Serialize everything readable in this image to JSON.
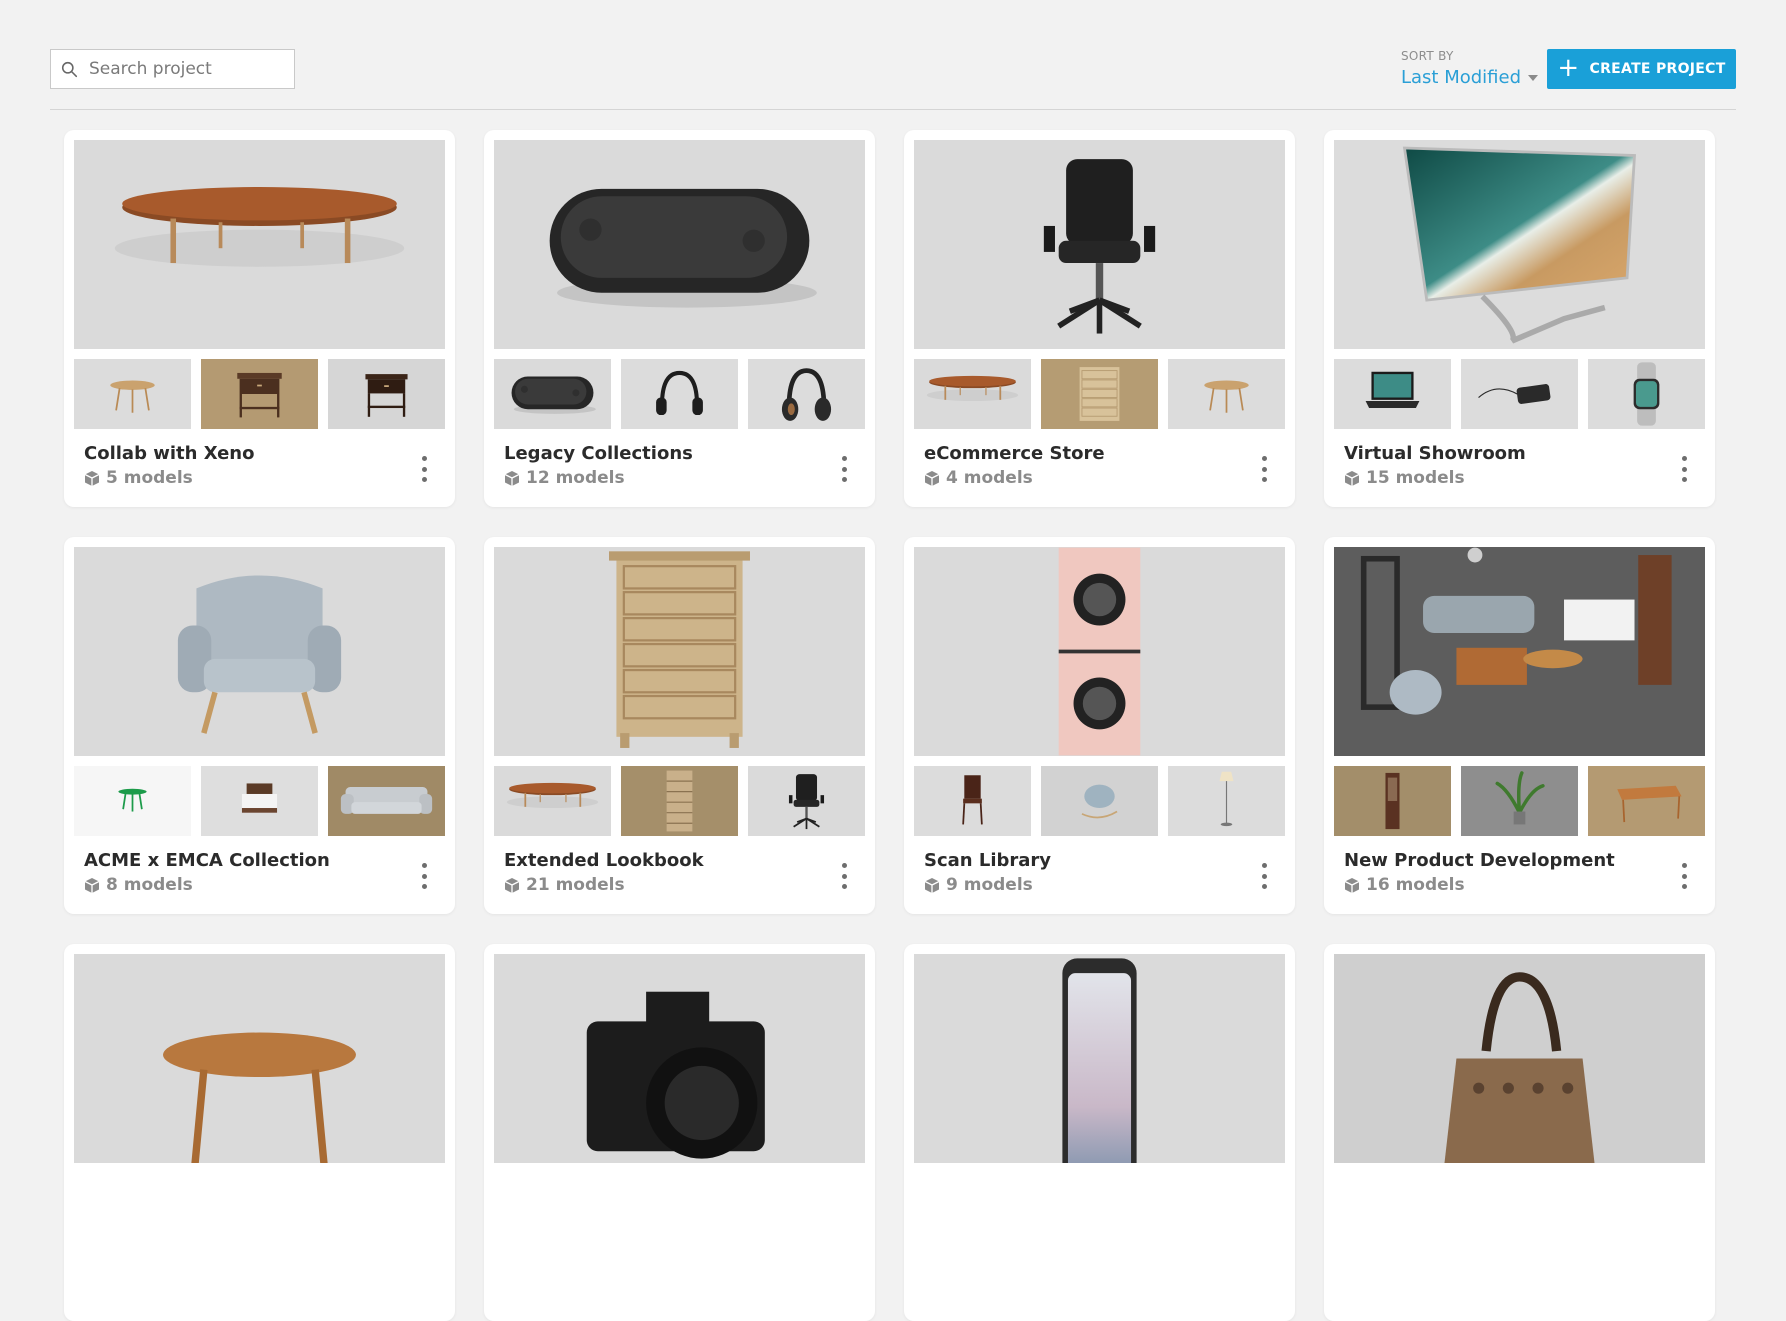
{
  "search": {
    "placeholder": "Search project",
    "value": ""
  },
  "sort": {
    "caption": "SORT BY",
    "value": "Last Modified"
  },
  "create_button": {
    "label": "CREATE PROJECT"
  },
  "projects": [
    {
      "title": "Collab with Xeno",
      "count": "5 models",
      "hero": "oval-coffee-table",
      "thumbs": [
        "round-side-table",
        "wood-nightstand",
        "dark-nightstand"
      ]
    },
    {
      "title": "Legacy Collections",
      "count": "12 models",
      "hero": "bluetooth-speaker",
      "thumbs": [
        "bluetooth-speaker",
        "headphones",
        "headphones-bronze"
      ]
    },
    {
      "title": "eCommerce Store",
      "count": "4 models",
      "hero": "office-chair",
      "thumbs": [
        "oval-coffee-table",
        "wood-dresser",
        "round-side-table"
      ]
    },
    {
      "title": "Virtual Showroom",
      "count": "15 models",
      "hero": "curved-tv",
      "thumbs": [
        "laptop",
        "power-bank",
        "smartwatch"
      ]
    },
    {
      "title": "ACME x EMCA Collection",
      "count": "8 models",
      "hero": "armchair",
      "thumbs": [
        "green-stool",
        "bed",
        "sofa"
      ]
    },
    {
      "title": "Extended Lookbook",
      "count": "21 models",
      "hero": "tall-dresser",
      "thumbs": [
        "oval-coffee-table",
        "bookshelf",
        "office-chair"
      ]
    },
    {
      "title": "Scan Library",
      "count": "9 models",
      "hero": "washer-dryer",
      "thumbs": [
        "wood-chair",
        "rocking-chair",
        "floor-lamp"
      ]
    },
    {
      "title": "New Product Development",
      "count": "16 models",
      "hero": "room-scene",
      "thumbs": [
        "hall-stand",
        "plant",
        "wood-table"
      ]
    },
    {
      "title": "",
      "count": "",
      "hero": "round-wood-table",
      "thumbs": []
    },
    {
      "title": "",
      "count": "",
      "hero": "camera",
      "thumbs": []
    },
    {
      "title": "",
      "count": "",
      "hero": "smartphone",
      "thumbs": []
    },
    {
      "title": "",
      "count": "",
      "hero": "handbag",
      "thumbs": []
    }
  ]
}
